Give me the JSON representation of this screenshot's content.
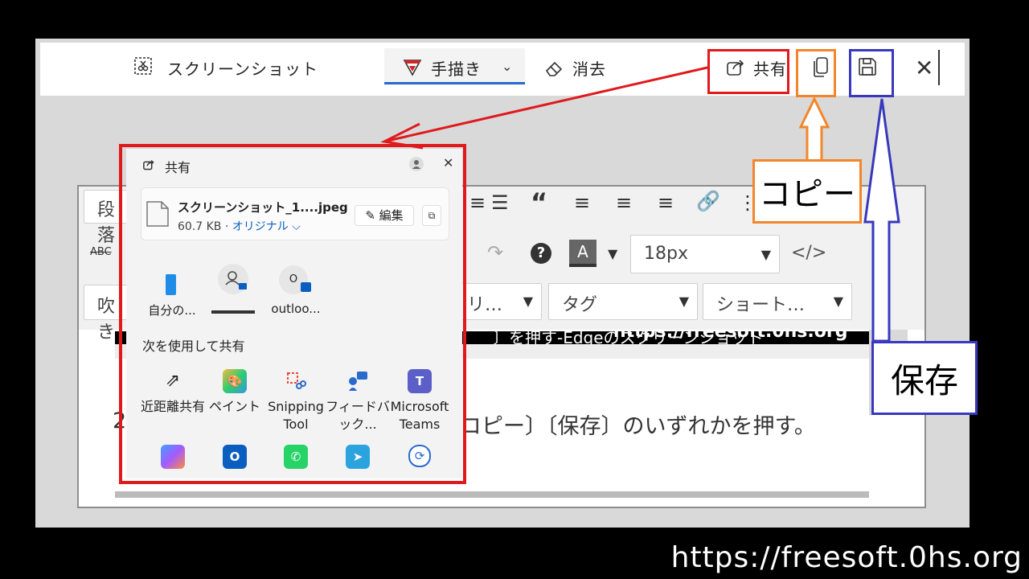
{
  "snip_toolbar": {
    "screenshot_label": "スクリーンショット",
    "draw_label": "手描き",
    "erase_label": "消去",
    "share_label": "共有"
  },
  "editor": {
    "paragraph_label": "段落",
    "strike_label": "ABC",
    "font_size_value": "18px",
    "fukidashi_label": "吹き",
    "category_label": "リ…",
    "tag_label": "タグ",
    "shortcode_label": "ショート…",
    "partial_text": "〕を押す-Edgeのスクリーンショット",
    "body_text": "コピー〕〔保存〕のいずれかを押す。",
    "body_text_prefix": "2",
    "watermark_text": "https://freesoft.0hs.org"
  },
  "share_panel": {
    "title": "共有",
    "file_name": "スクリーンショット_1....jpeg",
    "file_size": "60.7 KB",
    "file_quality": "オリジナル",
    "edit_label": "編集",
    "contacts": [
      {
        "label": "自分の..."
      },
      {
        "label": ""
      },
      {
        "label": "outloo..."
      }
    ],
    "section_label": "次を使用して共有",
    "apps": [
      {
        "label": "近距離共有",
        "icon": "nearby-share-icon"
      },
      {
        "label": "ペイント",
        "icon": "paint-icon"
      },
      {
        "label": "Snipping Tool",
        "icon": "snipping-tool-icon"
      },
      {
        "label": "フィードバック...",
        "icon": "feedback-icon"
      },
      {
        "label": "Microsoft Teams",
        "icon": "teams-icon"
      }
    ],
    "apps_row2": [
      {
        "label": "Copilot",
        "icon": "copilot-icon"
      },
      {
        "label": "Outlook",
        "icon": "outlook-icon"
      },
      {
        "label": "WhatsApp",
        "icon": "whatsapp-icon"
      },
      {
        "label": "Telegram",
        "icon": "telegram-icon"
      },
      {
        "label": "Link",
        "icon": "link-icon"
      }
    ]
  },
  "callouts": {
    "copy_label": "コピー",
    "save_label": "保存"
  },
  "site_url": "https://freesoft.0hs.org",
  "colors": {
    "highlight_red": "#e0191d",
    "highlight_orange": "#f3862a",
    "highlight_blue": "#3838bf",
    "link_blue": "#0a5ec0"
  }
}
